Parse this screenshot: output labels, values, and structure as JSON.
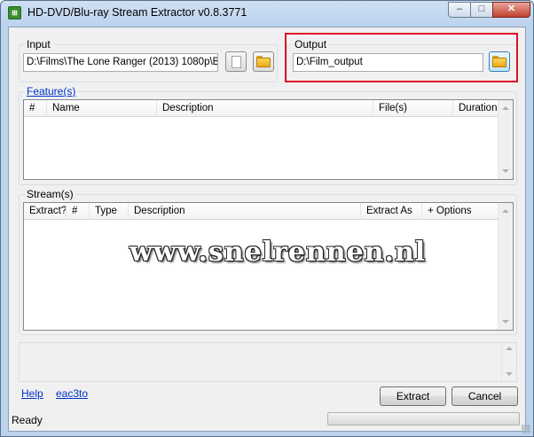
{
  "window": {
    "title": "HD-DVD/Blu-ray Stream Extractor v0.8.3771",
    "controls": {
      "minimize": "–",
      "maximize": "□",
      "close": "✕"
    }
  },
  "input": {
    "label": "Input",
    "value": "D:\\Films\\The Lone Ranger (2013) 1080p\\BD"
  },
  "output": {
    "label": "Output",
    "value": "D:\\Film_output"
  },
  "features": {
    "label": "Feature(s)",
    "columns": [
      "#",
      "Name",
      "Description",
      "File(s)",
      "Duration"
    ]
  },
  "streams": {
    "label": "Stream(s)",
    "columns": [
      "Extract?",
      "#",
      "Type",
      "Description",
      "Extract As",
      "+ Options"
    ]
  },
  "links": {
    "help": "Help",
    "eac3to": "eac3to"
  },
  "buttons": {
    "extract": "Extract",
    "cancel": "Cancel"
  },
  "status": {
    "text": "Ready",
    "progress": 0
  },
  "watermark": "www.snelrennen.nl",
  "colors": {
    "highlight": "#e0102a",
    "link": "#0033cc"
  }
}
